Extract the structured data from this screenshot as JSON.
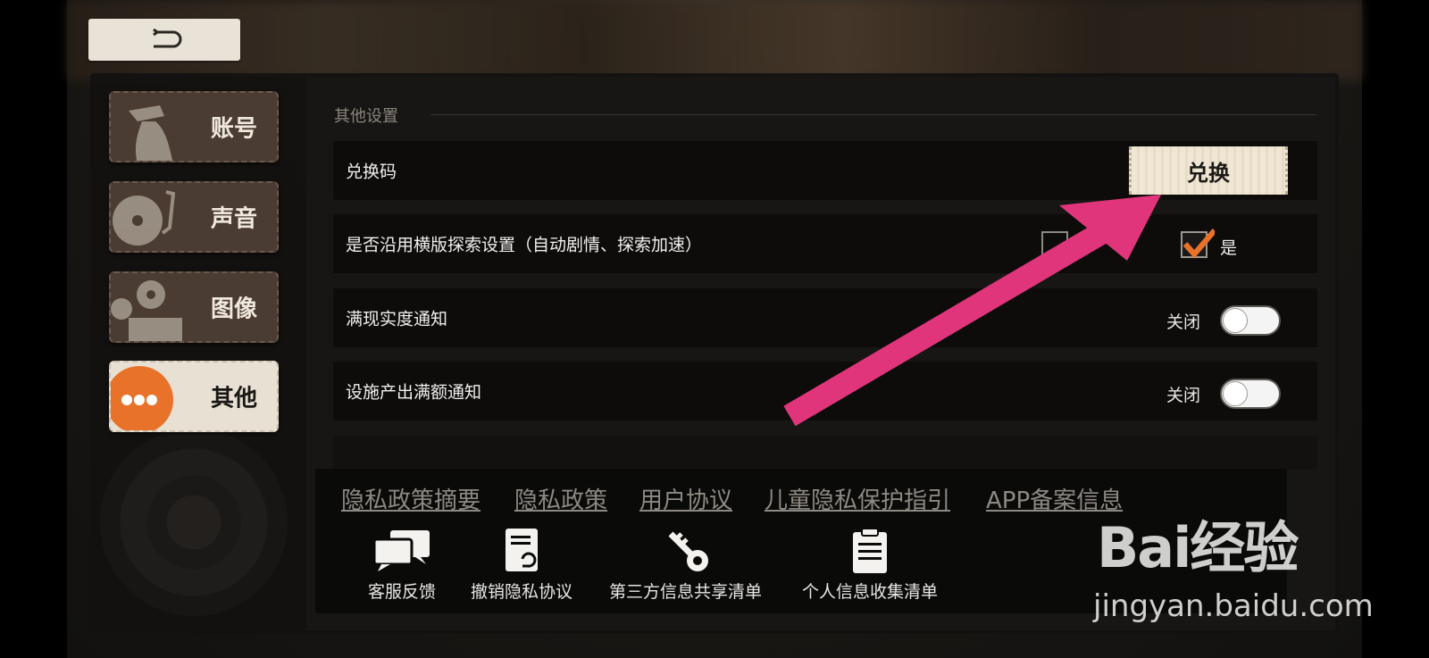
{
  "sidebar": {
    "items": [
      {
        "label": "账号",
        "icon": "detective-icon"
      },
      {
        "label": "声音",
        "icon": "turntable-icon"
      },
      {
        "label": "图像",
        "icon": "film-projector-icon"
      },
      {
        "label": "其他",
        "icon": "more-dots-icon"
      }
    ],
    "active_index": 3
  },
  "section": {
    "title": "其他设置"
  },
  "settings": {
    "redeem": {
      "label": "兑换码",
      "button_label": "兑换"
    },
    "explore": {
      "label": "是否沿用横版探索设置（自动剧情、探索加速）",
      "yes_label": "是",
      "no_checked": false,
      "yes_checked": true
    },
    "fulfillment": {
      "label": "满现实度通知",
      "state_label": "关闭",
      "on": false
    },
    "facility": {
      "label": "设施产出满额通知",
      "state_label": "关闭",
      "on": false
    }
  },
  "footer": {
    "links": [
      "隐私政策摘要",
      "隐私政策",
      "用户协议",
      "儿童隐私保护指引",
      "APP备案信息"
    ],
    "buttons": [
      {
        "label": "客服反馈",
        "icon": "chat-bubbles-icon"
      },
      {
        "label": "撤销隐私协议",
        "icon": "document-revoke-icon"
      },
      {
        "label": "第三方信息共享清单",
        "icon": "key-icon"
      },
      {
        "label": "个人信息收集清单",
        "icon": "clipboard-icon"
      }
    ]
  },
  "watermark": {
    "logo": "Bai经验",
    "url": "jingyan.baidu.com"
  },
  "colors": {
    "accent_orange": "#e8722a",
    "annotation_arrow": "#e0357a",
    "checkmark": "#e8722a"
  }
}
